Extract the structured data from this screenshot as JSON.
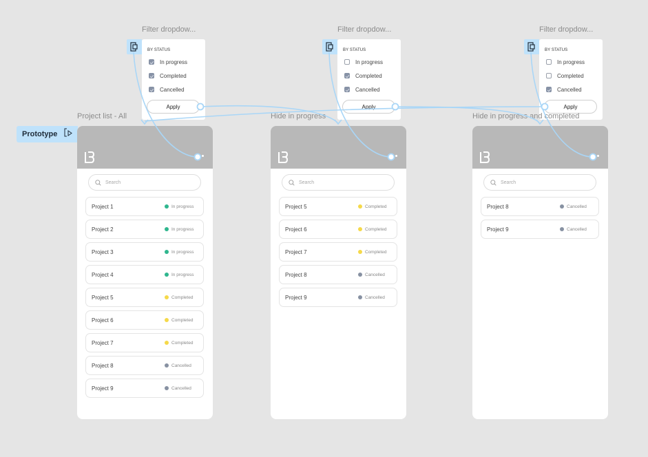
{
  "prototype_tag": {
    "label": "Prototype",
    "icon": "play-frame-icon"
  },
  "colors": {
    "canvas": "#e5e5e5",
    "connector": "#a9d6f7",
    "status_in_progress": "#2fb68e",
    "status_completed": "#f5d94a",
    "status_cancelled": "#8791a2",
    "header": "#b8b8b8"
  },
  "dropdowns": [
    {
      "frame_label": "Filter dropdow...",
      "title": "BY STATUS",
      "options": [
        {
          "label": "In progress",
          "checked": true
        },
        {
          "label": "Completed",
          "checked": true
        },
        {
          "label": "Cancelled",
          "checked": true
        }
      ],
      "apply_label": "Apply"
    },
    {
      "frame_label": "Filter dropdow...",
      "title": "BY STATUS",
      "options": [
        {
          "label": "In progress",
          "checked": false
        },
        {
          "label": "Completed",
          "checked": true
        },
        {
          "label": "Cancelled",
          "checked": true
        }
      ],
      "apply_label": "Apply"
    },
    {
      "frame_label": "Filter dropdow...",
      "title": "BY STATUS",
      "options": [
        {
          "label": "In progress",
          "checked": false
        },
        {
          "label": "Completed",
          "checked": false
        },
        {
          "label": "Cancelled",
          "checked": true
        }
      ],
      "apply_label": "Apply"
    }
  ],
  "screens": [
    {
      "frame_label": "Project list - All",
      "search_placeholder": "Search",
      "projects": [
        {
          "name": "Project 1",
          "status": "In progress",
          "status_key": "in_progress"
        },
        {
          "name": "Project 2",
          "status": "In progress",
          "status_key": "in_progress"
        },
        {
          "name": "Project 3",
          "status": "In progress",
          "status_key": "in_progress"
        },
        {
          "name": "Project 4",
          "status": "In progress",
          "status_key": "in_progress"
        },
        {
          "name": "Project 5",
          "status": "Completed",
          "status_key": "completed"
        },
        {
          "name": "Project 6",
          "status": "Completed",
          "status_key": "completed"
        },
        {
          "name": "Project 7",
          "status": "Completed",
          "status_key": "completed"
        },
        {
          "name": "Project 8",
          "status": "Cancelled",
          "status_key": "cancelled"
        },
        {
          "name": "Project 9",
          "status": "Cancelled",
          "status_key": "cancelled"
        }
      ]
    },
    {
      "frame_label": "Hide in progress",
      "search_placeholder": "Search",
      "projects": [
        {
          "name": "Project 5",
          "status": "Completed",
          "status_key": "completed"
        },
        {
          "name": "Project 6",
          "status": "Completed",
          "status_key": "completed"
        },
        {
          "name": "Project 7",
          "status": "Completed",
          "status_key": "completed"
        },
        {
          "name": "Project 8",
          "status": "Cancelled",
          "status_key": "cancelled"
        },
        {
          "name": "Project 9",
          "status": "Cancelled",
          "status_key": "cancelled"
        }
      ]
    },
    {
      "frame_label": "Hide in progress and completed",
      "search_placeholder": "Search",
      "projects": [
        {
          "name": "Project 8",
          "status": "Cancelled",
          "status_key": "cancelled"
        },
        {
          "name": "Project 9",
          "status": "Cancelled",
          "status_key": "cancelled"
        }
      ]
    }
  ]
}
